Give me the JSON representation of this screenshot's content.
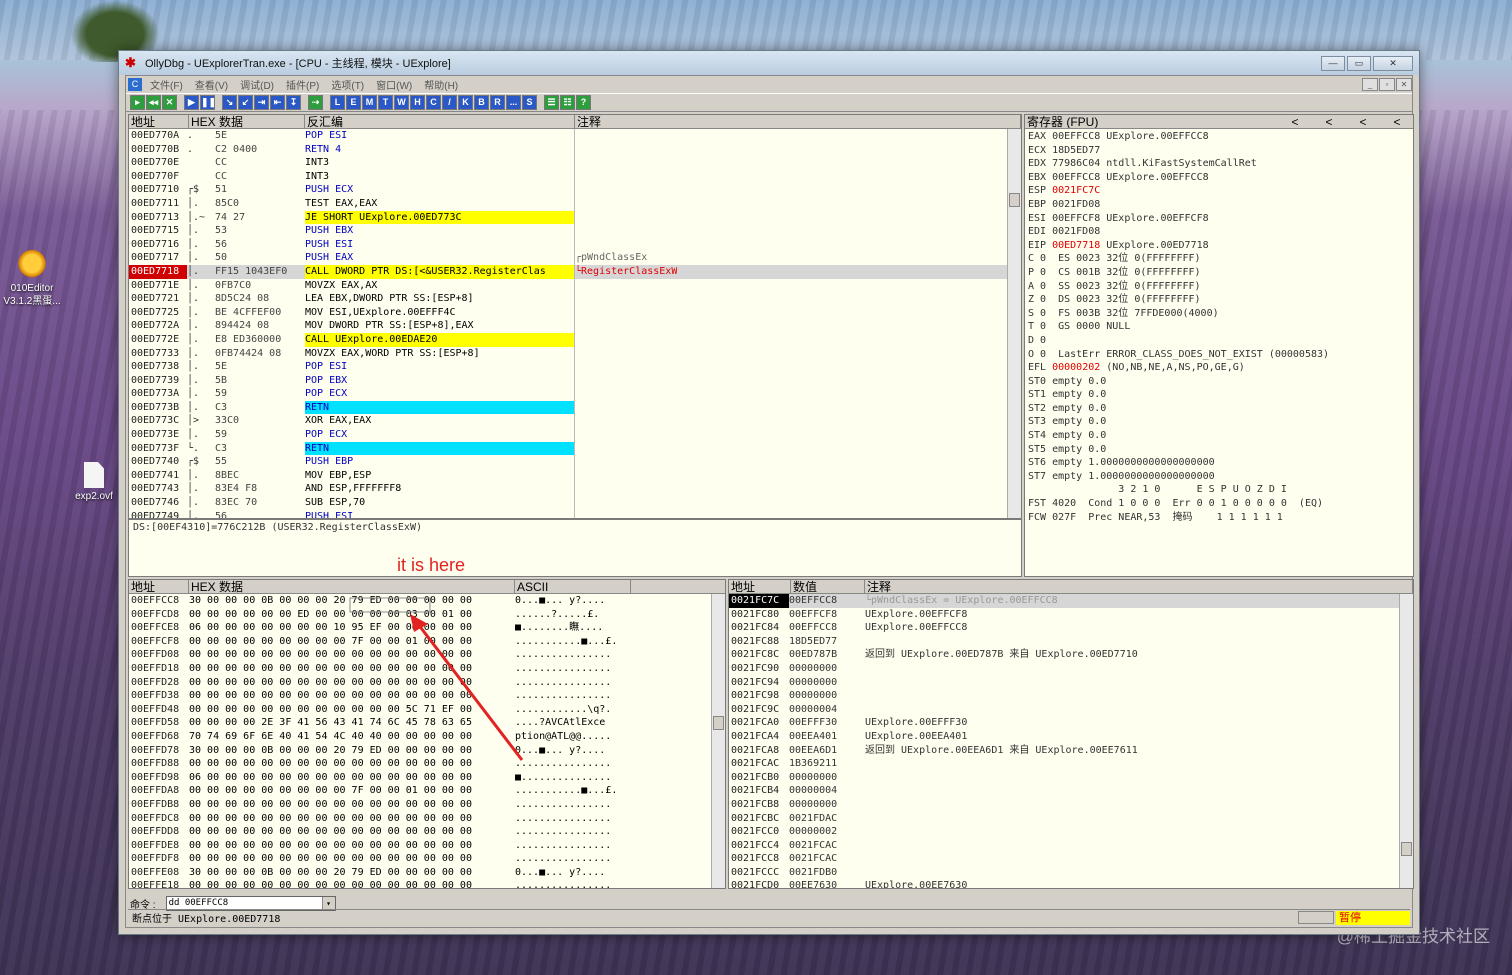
{
  "desktop": {
    "icons": [
      {
        "label": "010Editor\nV3.1.2黑蛋..."
      },
      {
        "label": "exp2.ovf"
      }
    ],
    "watermark": "@稀土掘金技术社区"
  },
  "window": {
    "title": "OllyDbg - UExplorerTran.exe - [CPU - 主线程, 模块 - UExplore]",
    "btn_min": "▭",
    "btn_max": "▭",
    "btn_close": "✕"
  },
  "menu": [
    "文件(F)",
    "查看(V)",
    "调试(D)",
    "插件(P)",
    "选项(T)",
    "窗口(W)",
    "帮助(H)"
  ],
  "toolbar": [
    "▸",
    "◂◂",
    "✕",
    "▶",
    "❚❚",
    "↘",
    "↙",
    "⇥",
    "⇤",
    "↧",
    "⇢",
    "L",
    "E",
    "M",
    "T",
    "W",
    "H",
    "C",
    "/",
    "K",
    "B",
    "R",
    "...",
    "S",
    "☰",
    "☷",
    "?"
  ],
  "cpu": {
    "headers": [
      "地址",
      "HEX 数据",
      "反汇编",
      "注释"
    ],
    "rows": [
      {
        "a": "00ED770A",
        "m": ".",
        "h": "5E",
        "d": "POP ESI",
        "c": ""
      },
      {
        "a": "00ED770B",
        "m": ".",
        "h": "C2 0400",
        "d": "RETN 4",
        "c": ""
      },
      {
        "a": "00ED770E",
        "m": "",
        "h": "CC",
        "d": "INT3",
        "c": ""
      },
      {
        "a": "00ED770F",
        "m": "",
        "h": "CC",
        "d": "INT3",
        "c": ""
      },
      {
        "a": "00ED7710",
        "m": "┌$",
        "h": "51",
        "d": "PUSH ECX",
        "c": ""
      },
      {
        "a": "00ED7711",
        "m": "│.",
        "h": "85C0",
        "d": "TEST EAX,EAX",
        "c": ""
      },
      {
        "a": "00ED7713",
        "m": "│.~",
        "h": "74 27",
        "d": "JE SHORT UExplore.00ED773C",
        "c": ""
      },
      {
        "a": "00ED7715",
        "m": "│.",
        "h": "53",
        "d": "PUSH EBX",
        "c": ""
      },
      {
        "a": "00ED7716",
        "m": "│.",
        "h": "56",
        "d": "PUSH ESI",
        "c": ""
      },
      {
        "a": "00ED7717",
        "m": "│.",
        "h": "50",
        "d": "PUSH EAX",
        "c": "┌pWndClassEx"
      },
      {
        "a": "00ED7718",
        "m": "│.",
        "h": "FF15 1043EF0",
        "d": "CALL DWORD PTR DS:[<&USER32.RegisterClas",
        "c": "└RegisterClassExW"
      },
      {
        "a": "00ED771E",
        "m": "│.",
        "h": "0FB7C0",
        "d": "MOVZX EAX,AX",
        "c": ""
      },
      {
        "a": "00ED7721",
        "m": "│.",
        "h": "8D5C24 08",
        "d": "LEA EBX,DWORD PTR SS:[ESP+8]",
        "c": ""
      },
      {
        "a": "00ED7725",
        "m": "│.",
        "h": "BE 4CFFEF00",
        "d": "MOV ESI,UExplore.00EFFF4C",
        "c": ""
      },
      {
        "a": "00ED772A",
        "m": "│.",
        "h": "894424 08",
        "d": "MOV DWORD PTR SS:[ESP+8],EAX",
        "c": ""
      },
      {
        "a": "00ED772E",
        "m": "│.",
        "h": "E8 ED360000",
        "d": "CALL UExplore.00EDAE20",
        "c": ""
      },
      {
        "a": "00ED7733",
        "m": "│.",
        "h": "0FB74424 08",
        "d": "MOVZX EAX,WORD PTR SS:[ESP+8]",
        "c": ""
      },
      {
        "a": "00ED7738",
        "m": "│.",
        "h": "5E",
        "d": "POP ESI",
        "c": ""
      },
      {
        "a": "00ED7739",
        "m": "│.",
        "h": "5B",
        "d": "POP EBX",
        "c": ""
      },
      {
        "a": "00ED773A",
        "m": "│.",
        "h": "59",
        "d": "POP ECX",
        "c": ""
      },
      {
        "a": "00ED773B",
        "m": "│.",
        "h": "C3",
        "d": "RETN",
        "c": ""
      },
      {
        "a": "00ED773C",
        "m": "│>",
        "h": "33C0",
        "d": "XOR EAX,EAX",
        "c": ""
      },
      {
        "a": "00ED773E",
        "m": "│.",
        "h": "59",
        "d": "POP ECX",
        "c": ""
      },
      {
        "a": "00ED773F",
        "m": "└.",
        "h": "C3",
        "d": "RETN",
        "c": ""
      },
      {
        "a": "00ED7740",
        "m": "┌$",
        "h": "55",
        "d": "PUSH EBP",
        "c": ""
      },
      {
        "a": "00ED7741",
        "m": "│.",
        "h": "8BEC",
        "d": "MOV EBP,ESP",
        "c": ""
      },
      {
        "a": "00ED7743",
        "m": "│.",
        "h": "83E4 F8",
        "d": "AND ESP,FFFFFFF8",
        "c": ""
      },
      {
        "a": "00ED7746",
        "m": "│.",
        "h": "83EC 70",
        "d": "SUB ESP,70",
        "c": ""
      },
      {
        "a": "00ED7749",
        "m": "│.",
        "h": "56",
        "d": "PUSH ESI",
        "c": ""
      }
    ],
    "info_line": "DS:[00EF4310]=776C212B (USER32.RegisterClassExW)"
  },
  "registers": {
    "header": "寄存器 (FPU)",
    "nav": [
      "<",
      "<",
      "<",
      "<"
    ],
    "lines": [
      "EAX 00EFFCC8 UExplore.00EFFCC8",
      "ECX 18D5ED77",
      "EDX 77986C04 ntdll.KiFastSystemCallRet",
      "EBX 00EFFCC8 UExplore.00EFFCC8",
      "ESP 0021FC7C",
      "EBP 0021FD08",
      "ESI 00EFFCF8 UExplore.00EFFCF8",
      "EDI 0021FD08",
      "",
      "EIP 00ED7718 UExplore.00ED7718",
      "",
      "C 0  ES 0023 32位 0(FFFFFFFF)",
      "P 0  CS 001B 32位 0(FFFFFFFF)",
      "A 0  SS 0023 32位 0(FFFFFFFF)",
      "Z 0  DS 0023 32位 0(FFFFFFFF)",
      "S 0  FS 003B 32位 7FFDE000(4000)",
      "T 0  GS 0000 NULL",
      "D 0",
      "O 0  LastErr ERROR_CLASS_DOES_NOT_EXIST (00000583)",
      "",
      "EFL 00000202 (NO,NB,NE,A,NS,PO,GE,G)",
      "",
      "ST0 empty 0.0",
      "ST1 empty 0.0",
      "ST2 empty 0.0",
      "ST3 empty 0.0",
      "ST4 empty 0.0",
      "ST5 empty 0.0",
      "ST6 empty 1.0000000000000000000",
      "ST7 empty 1.0000000000000000000",
      "               3 2 1 0      E S P U O Z D I",
      "FST 4020  Cond 1 0 0 0  Err 0 0 1 0 0 0 0 0  (EQ)",
      "FCW 027F  Prec NEAR,53  掩码    1 1 1 1 1 1"
    ]
  },
  "dump": {
    "headers": [
      "地址",
      "HEX 数据",
      "ASCII"
    ],
    "rows": [
      {
        "a": "00EFFCC8",
        "h": "30 00 00 00 0B 00 00 00 20 79 ED 00 00 00 00 00",
        "s": "0...■... y?...."
      },
      {
        "a": "00EFFCD8",
        "h": "00 00 00 00 00 00 ED 00 00 00 00 00 03 00 01 00",
        "s": "......?.....£."
      },
      {
        "a": "00EFFCE8",
        "h": "06 00 00 00 00 00 00 00 10 95 EF 00 00 00 00 00",
        "s": "■........瞴...."
      },
      {
        "a": "00EFFCF8",
        "h": "00 00 00 00 00 00 00 00 00 7F 00 00 01 00 00 00",
        "s": "...........■...£."
      },
      {
        "a": "00EFFD08",
        "h": "00 00 00 00 00 00 00 00 00 00 00 00 00 00 00 00",
        "s": "................"
      },
      {
        "a": "00EFFD18",
        "h": "00 00 00 00 00 00 00 00 00 00 00 00 00 00 00 00",
        "s": "................"
      },
      {
        "a": "00EFFD28",
        "h": "00 00 00 00 00 00 00 00 00 00 00 00 00 00 00 00",
        "s": "................"
      },
      {
        "a": "00EFFD38",
        "h": "00 00 00 00 00 00 00 00 00 00 00 00 00 00 00 00",
        "s": "................"
      },
      {
        "a": "00EFFD48",
        "h": "00 00 00 00 00 00 00 00 00 00 00 00 5C 71 EF 00",
        "s": "............\\q?."
      },
      {
        "a": "00EFFD58",
        "h": "00 00 00 00 2E 3F 41 56 43 41 74 6C 45 78 63 65",
        "s": "....?AVCAtlExce"
      },
      {
        "a": "00EFFD68",
        "h": "70 74 69 6F 6E 40 41 54 4C 40 40 00 00 00 00 00",
        "s": "ption@ATL@@....."
      },
      {
        "a": "00EFFD78",
        "h": "30 00 00 00 0B 00 00 00 20 79 ED 00 00 00 00 00",
        "s": "0...■... y?...."
      },
      {
        "a": "00EFFD88",
        "h": "00 00 00 00 00 00 00 00 00 00 00 00 00 00 00 00",
        "s": "................"
      },
      {
        "a": "00EFFD98",
        "h": "06 00 00 00 00 00 00 00 00 00 00 00 00 00 00 00",
        "s": "■..............."
      },
      {
        "a": "00EFFDA8",
        "h": "00 00 00 00 00 00 00 00 00 7F 00 00 01 00 00 00",
        "s": "...........■...£."
      },
      {
        "a": "00EFFDB8",
        "h": "00 00 00 00 00 00 00 00 00 00 00 00 00 00 00 00",
        "s": "................"
      },
      {
        "a": "00EFFDC8",
        "h": "00 00 00 00 00 00 00 00 00 00 00 00 00 00 00 00",
        "s": "................"
      },
      {
        "a": "00EFFDD8",
        "h": "00 00 00 00 00 00 00 00 00 00 00 00 00 00 00 00",
        "s": "................"
      },
      {
        "a": "00EFFDE8",
        "h": "00 00 00 00 00 00 00 00 00 00 00 00 00 00 00 00",
        "s": "................"
      },
      {
        "a": "00EFFDF8",
        "h": "00 00 00 00 00 00 00 00 00 00 00 00 00 00 00 00",
        "s": "................"
      },
      {
        "a": "00EFFE08",
        "h": "30 00 00 00 0B 00 00 00 20 79 ED 00 00 00 00 00",
        "s": "0...■... y?...."
      },
      {
        "a": "00EFFE18",
        "h": "00 00 00 00 00 00 00 00 00 00 00 00 00 00 00 00",
        "s": "................"
      }
    ]
  },
  "stack": {
    "headers": [
      "地址",
      "数值",
      "注释"
    ],
    "rows": [
      {
        "a": "0021FC7C",
        "v": "00EFFCC8",
        "c": "└pWndClassEx = UExplore.00EFFCC8"
      },
      {
        "a": "0021FC80",
        "v": "00EFFCF8",
        "c": "UExplore.00EFFCF8"
      },
      {
        "a": "0021FC84",
        "v": "00EFFCC8",
        "c": "UExplore.00EFFCC8"
      },
      {
        "a": "0021FC88",
        "v": "18D5ED77",
        "c": ""
      },
      {
        "a": "0021FC8C",
        "v": "00ED787B",
        "c": "返回到 UExplore.00ED787B 来自 UExplore.00ED7710"
      },
      {
        "a": "0021FC90",
        "v": "00000000",
        "c": ""
      },
      {
        "a": "0021FC94",
        "v": "00000000",
        "c": ""
      },
      {
        "a": "0021FC98",
        "v": "00000000",
        "c": ""
      },
      {
        "a": "0021FC9C",
        "v": "00000004",
        "c": ""
      },
      {
        "a": "0021FCA0",
        "v": "00EFFF30",
        "c": "UExplore.00EFFF30"
      },
      {
        "a": "0021FCA4",
        "v": "00EEA401",
        "c": "UExplore.00EEA401"
      },
      {
        "a": "0021FCA8",
        "v": "00EEA6D1",
        "c": "返回到 UExplore.00EEA6D1 来自 UExplore.00EE7611"
      },
      {
        "a": "0021FCAC",
        "v": "1B369211",
        "c": ""
      },
      {
        "a": "0021FCB0",
        "v": "00000000",
        "c": ""
      },
      {
        "a": "0021FCB4",
        "v": "00000004",
        "c": ""
      },
      {
        "a": "0021FCB8",
        "v": "00000000",
        "c": ""
      },
      {
        "a": "0021FCBC",
        "v": "0021FDAC",
        "c": ""
      },
      {
        "a": "0021FCC0",
        "v": "00000002",
        "c": ""
      },
      {
        "a": "0021FCC4",
        "v": "0021FCAC",
        "c": ""
      },
      {
        "a": "0021FCC8",
        "v": "0021FCAC",
        "c": ""
      },
      {
        "a": "0021FCCC",
        "v": "0021FDB0",
        "c": ""
      },
      {
        "a": "0021FCD0",
        "v": "00EE7630",
        "c": "UExplore.00EE7630"
      }
    ]
  },
  "command": {
    "label": "命令 :",
    "value": "dd 00EFFCC8",
    "dropdown": "▾"
  },
  "status": {
    "text": "断点位于 UExplore.00ED7718",
    "state": "暂停"
  },
  "annotation": {
    "text": "it is here",
    "color": "#e32222"
  }
}
